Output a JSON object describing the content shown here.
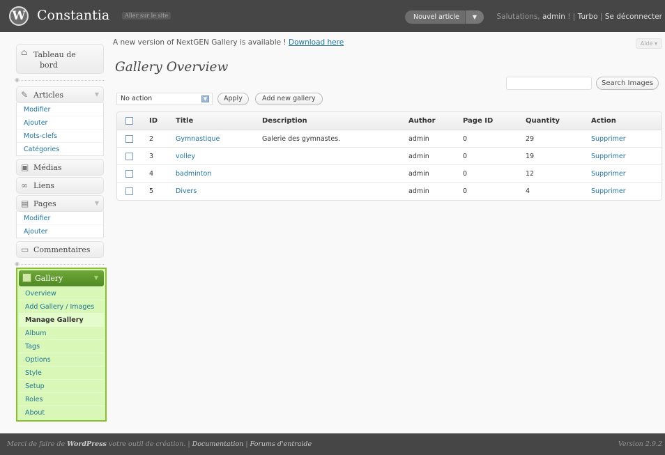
{
  "header": {
    "logo_glyph": "W",
    "site_title": "Constantia",
    "visit_site": "Aller sur le site",
    "new_post": "Nouvel article",
    "new_post_toggle": "▼",
    "greeting_prefix": "Salutations, ",
    "user": "admin",
    "greeting_suffix": " ! | ",
    "turbo": "Turbo",
    "sep": " | ",
    "logout": "Se déconnecter"
  },
  "update_nag": {
    "text": "A new version of NextGEN Gallery is available ! ",
    "link": "Download here"
  },
  "help": "Aide ▾",
  "page_title": "Gallery Overview",
  "search": {
    "button": "Search Images",
    "value": ""
  },
  "bulk": {
    "selected": "No action",
    "apply": "Apply",
    "add_gallery": "Add new gallery"
  },
  "sidebar": {
    "dashboard": {
      "icon": "⌂",
      "label_line1": "Tableau de",
      "label_line2": "bord"
    },
    "articles": {
      "icon": "✎",
      "label": "Articles",
      "items": [
        "Modifier",
        "Ajouter",
        "Mots-clefs",
        "Catégories"
      ]
    },
    "medias": {
      "icon": "▣",
      "label": "Médias"
    },
    "liens": {
      "icon": "∞",
      "label": "Liens"
    },
    "pages": {
      "icon": "▤",
      "label": "Pages",
      "items": [
        "Modifier",
        "Ajouter"
      ]
    },
    "comments": {
      "icon": "▭",
      "label": "Commentaires"
    },
    "gallery": {
      "label": "Gallery",
      "items": [
        "Overview",
        "Add Gallery / Images",
        "Manage Gallery",
        "Album",
        "Tags",
        "Options",
        "Style",
        "Setup",
        "Roles",
        "About"
      ],
      "current": "Manage Gallery"
    }
  },
  "table": {
    "headers": {
      "id": "ID",
      "title": "Title",
      "description": "Description",
      "author": "Author",
      "page_id": "Page ID",
      "quantity": "Quantity",
      "action": "Action"
    },
    "rows": [
      {
        "id": "2",
        "title": "Gymnastique",
        "description": "Galerie des gymnastes.",
        "author": "admin",
        "page_id": "0",
        "quantity": "29",
        "action": "Supprimer"
      },
      {
        "id": "3",
        "title": "volley",
        "description": "",
        "author": "admin",
        "page_id": "0",
        "quantity": "19",
        "action": "Supprimer"
      },
      {
        "id": "4",
        "title": "badminton",
        "description": "",
        "author": "admin",
        "page_id": "0",
        "quantity": "12",
        "action": "Supprimer"
      },
      {
        "id": "5",
        "title": "Divers",
        "description": "",
        "author": "admin",
        "page_id": "0",
        "quantity": "4",
        "action": "Supprimer"
      }
    ]
  },
  "footer": {
    "thanks_prefix": "Merci de faire de ",
    "wordpress": "WordPress",
    "thanks_suffix": " votre outil de création. | ",
    "documentation": "Documentation",
    "sep": " | ",
    "forums": "Forums d'entraide",
    "version": "Version 2.9.2"
  }
}
